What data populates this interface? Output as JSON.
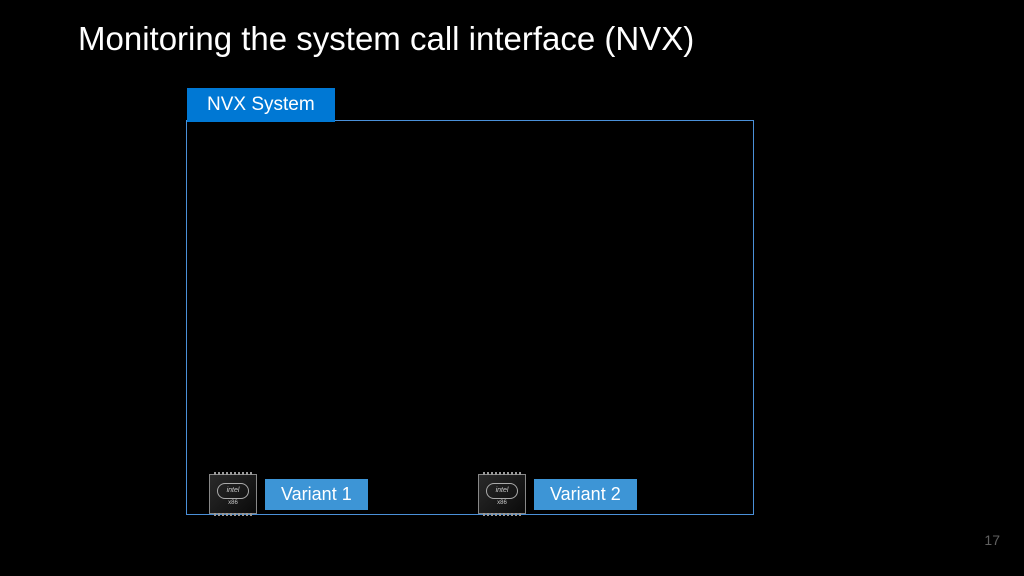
{
  "slide": {
    "title": "Monitoring the system call interface (NVX)",
    "number": "17"
  },
  "diagram": {
    "system_label": "NVX System",
    "chip": {
      "brand": "intel",
      "arch": "x86"
    },
    "variants": [
      {
        "label": "Variant 1"
      },
      {
        "label": "Variant 2"
      }
    ]
  }
}
